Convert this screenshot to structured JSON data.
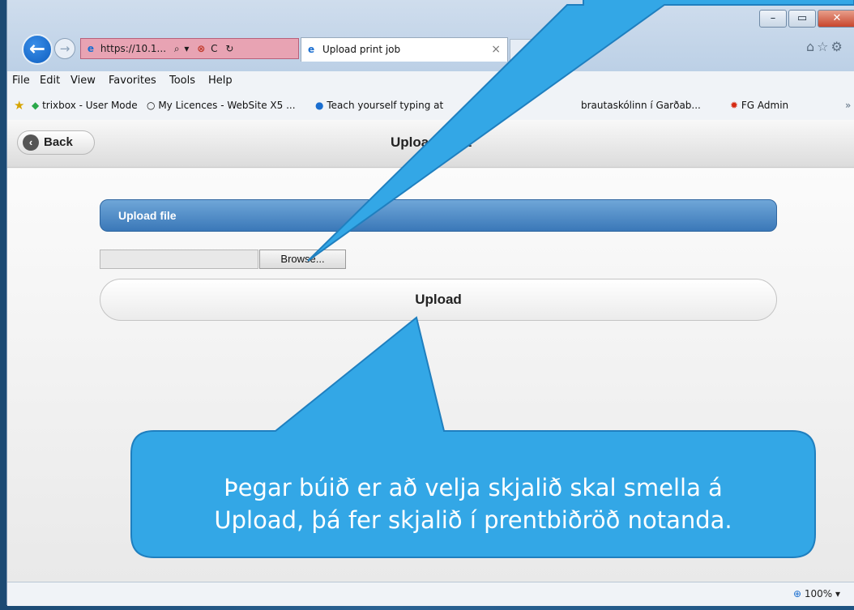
{
  "browser": {
    "address": "https://10.1...",
    "tab_title": "Upload print job",
    "tab_close": "×",
    "window_controls": {
      "minimize": "–",
      "maximize": "▭",
      "close": "✕"
    },
    "right_icons": "⌂☆⚙",
    "menu": [
      "File",
      "Edit",
      "View",
      "Favorites",
      "Tools",
      "Help"
    ],
    "favorites": [
      "trixbox - User Mode",
      "My Licences - WebSite X5 ...",
      "Teach yourself typing at",
      "brautaskólinn í Garðab...",
      "FG Admin"
    ],
    "favorites_more": "»",
    "zoom": "100%"
  },
  "page": {
    "back_label": "Back",
    "title": "Upload print",
    "section_title": "Upload file",
    "browse_label": "Browse...",
    "upload_label": "Upload"
  },
  "callout": {
    "text_line1": "Þegar búið er að velja skjalið skal smella á",
    "text_line2": "Upload, þá fer skjalið í prentbiðröð notanda."
  },
  "colors": {
    "callout_fill": "#33a7e6",
    "callout_border": "#1f7fbf",
    "section_bar": "#4a87c4"
  }
}
